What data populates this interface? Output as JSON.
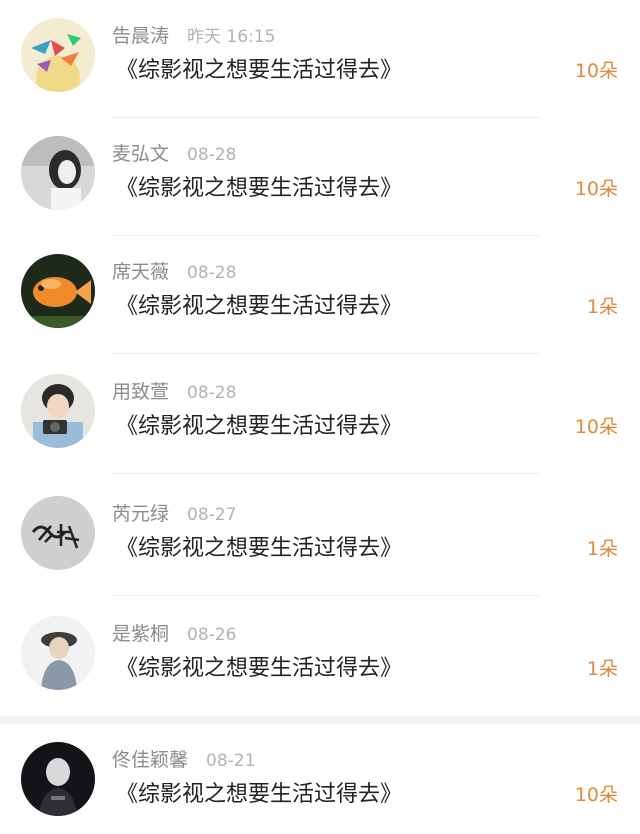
{
  "gifts": [
    {
      "name": "告晨涛",
      "time": "昨天 16:15",
      "title": "《综影视之想要生活过得去》",
      "amount": "10朵",
      "avatar": "paper-cranes-avatar"
    },
    {
      "name": "麦弘文",
      "time": "08-28",
      "title": "《综影视之想要生活过得去》",
      "amount": "10朵",
      "avatar": "girl-bw-avatar"
    },
    {
      "name": "席天薇",
      "time": "08-28",
      "title": "《综影视之想要生活过得去》",
      "amount": "1朵",
      "avatar": "goldfish-avatar"
    },
    {
      "name": "用致萱",
      "time": "08-28",
      "title": "《综影视之想要生活过得去》",
      "amount": "10朵",
      "avatar": "camera-boy-avatar"
    },
    {
      "name": "芮元绿",
      "time": "08-27",
      "title": "《综影视之想要生活过得去》",
      "amount": "1朵",
      "avatar": "calligraphy-avatar"
    },
    {
      "name": "是紫桐",
      "time": "08-26",
      "title": "《综影视之想要生活过得去》",
      "amount": "1朵",
      "avatar": "hat-person-avatar"
    },
    {
      "name": "佟佳颖馨",
      "time": "08-21",
      "title": "《综影视之想要生活过得去》",
      "amount": "10朵",
      "avatar": "dark-figure-avatar"
    }
  ],
  "colors": {
    "amount": "#e08a3c",
    "title": "#222222",
    "meta": "#9a9a9a"
  }
}
